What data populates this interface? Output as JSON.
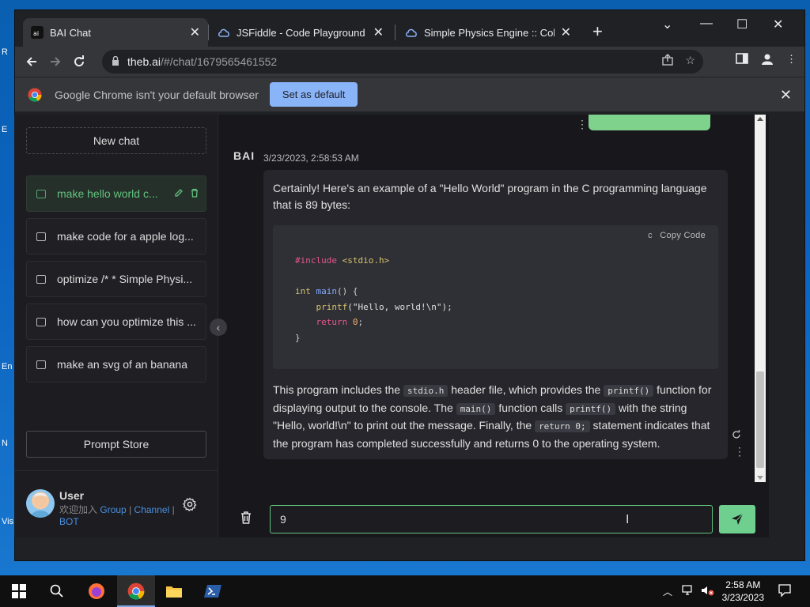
{
  "browser": {
    "tabs": [
      {
        "title": "BAI Chat",
        "active": true
      },
      {
        "title": "JSFiddle - Code Playground",
        "active": false
      },
      {
        "title": "Simple Physics Engine :: Collision",
        "active": false
      }
    ],
    "url_host": "theb.ai",
    "url_path": "/#/chat/1679565461552",
    "infobar_message": "Google Chrome isn't your default browser",
    "infobar_button": "Set as default"
  },
  "sidebar": {
    "new_chat": "New chat",
    "chats": [
      {
        "label": "make hello world c...",
        "active": true
      },
      {
        "label": "make code for a apple log...",
        "active": false
      },
      {
        "label": "optimize /* * Simple Physi...",
        "active": false
      },
      {
        "label": "how can you optimize this ...",
        "active": false
      },
      {
        "label": "make an svg of an banana",
        "active": false
      }
    ],
    "prompt_store": "Prompt Store",
    "user": {
      "name": "User",
      "join_text": "欢迎加入",
      "link_group": "Group",
      "link_channel": "Channel",
      "link_bot": "BOT",
      "sep": "|"
    }
  },
  "message": {
    "bot_name": "BAI",
    "timestamp": "3/23/2023, 2:58:53 AM",
    "intro": "Certainly! Here's an example of a \"Hello World\" program in the C programming language that is 89 bytes:",
    "code_lang": "c",
    "copy_label": "Copy Code",
    "code_lines": {
      "l1_kw": "#include",
      "l1_rest": " <stdio.h>",
      "l3_type": "int",
      "l3_fn": "main",
      "l3_rest": "() {",
      "l4_fn": "printf",
      "l4_str": "(\"Hello, world!\\n\");",
      "l5_kw": "return",
      "l5_num": "0",
      "l5_rest": ";",
      "l6": "}"
    },
    "explain": {
      "t1": "This program includes the ",
      "c1": "stdio.h",
      "t2": " header file, which provides the ",
      "c2": "printf()",
      "t3": " function for displaying output to the console. The ",
      "c3": "main()",
      "t4": " function calls ",
      "c4": "printf()",
      "t5": " with the string \"Hello, world!\\n\" to print out the message. Finally, the ",
      "c5": "return 0;",
      "t6": " statement indicates that the program has completed successfully and returns 0 to the operating system."
    }
  },
  "composer": {
    "input_value": "9"
  },
  "taskbar": {
    "time": "2:58 AM",
    "date": "3/23/2023"
  },
  "colors": {
    "accent_green": "#63c27f",
    "send_green": "#6fcf8f",
    "link_blue": "#4a90e2",
    "chrome_blue": "#8ab4f8"
  }
}
